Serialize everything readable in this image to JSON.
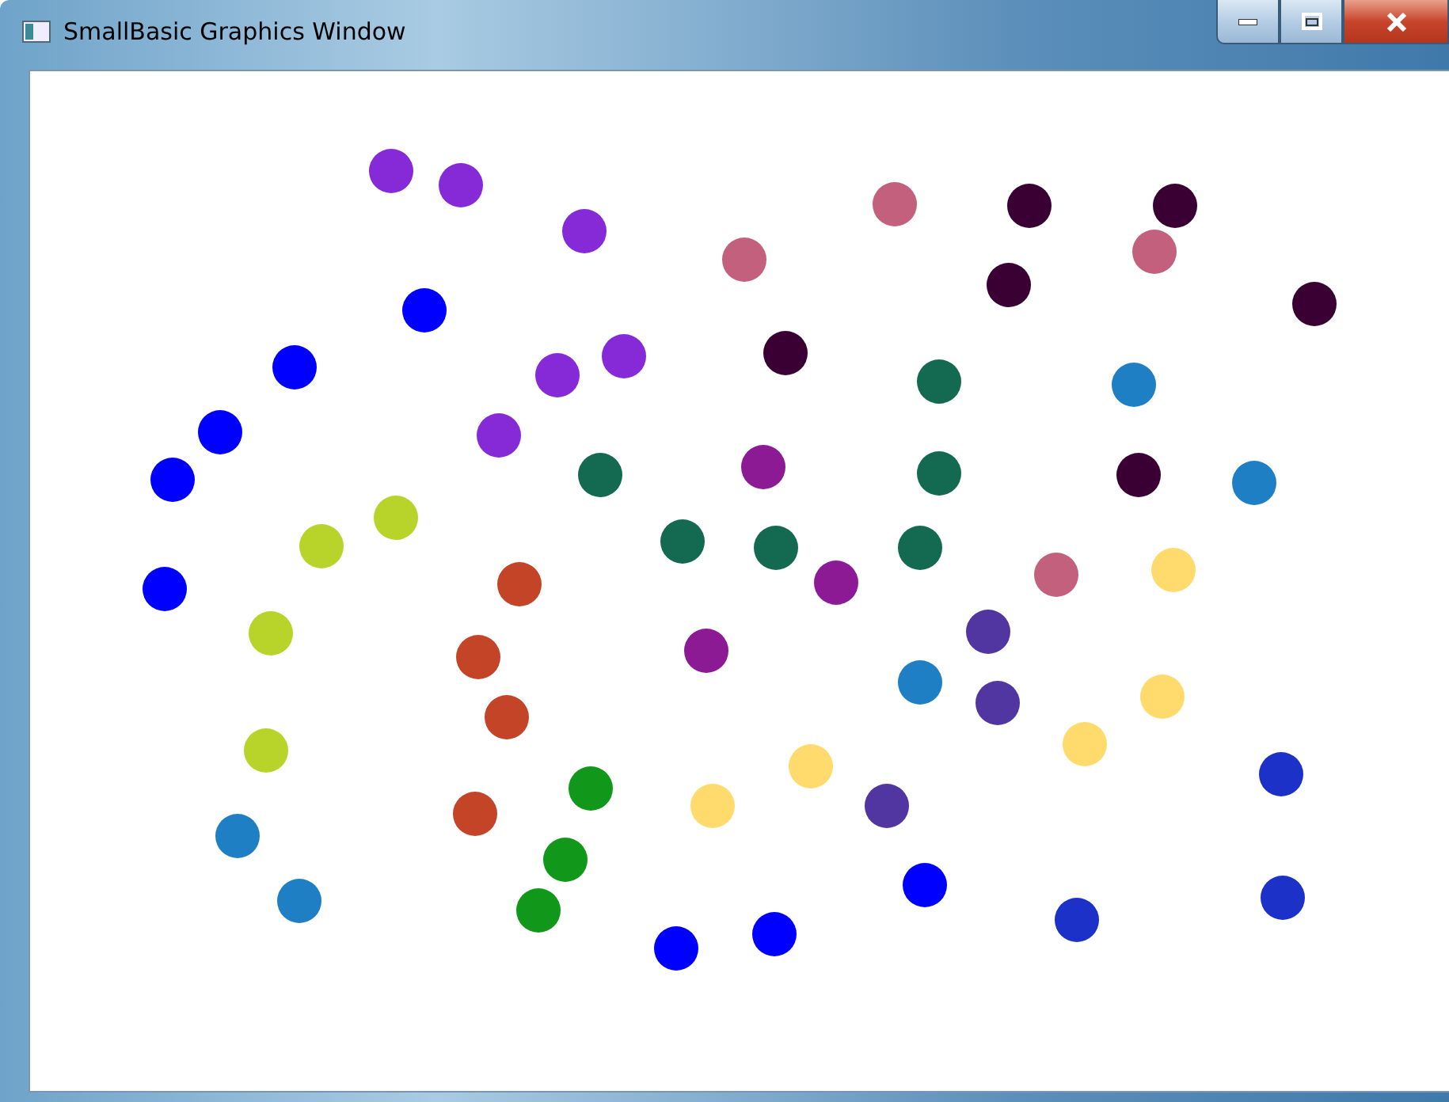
{
  "window": {
    "title": "SmallBasic Graphics Window"
  },
  "dots": [
    {
      "color": "#8629d6"
    },
    {
      "color": "#8629d6"
    },
    {
      "color": "#8629d6"
    },
    {
      "color": "#8629d6"
    },
    {
      "color": "#8629d6"
    },
    {
      "color": "#8629d6"
    },
    {
      "color": "#0000ff"
    },
    {
      "color": "#0000ff"
    },
    {
      "color": "#0000ff"
    },
    {
      "color": "#0000ff"
    },
    {
      "color": "#0000ff"
    },
    {
      "color": "#0000ff"
    },
    {
      "color": "#0000ff"
    },
    {
      "color": "#0000ff"
    },
    {
      "color": "#c2607e"
    },
    {
      "color": "#c2607e"
    },
    {
      "color": "#c2607e"
    },
    {
      "color": "#c2607e"
    },
    {
      "color": "#3a0034"
    },
    {
      "color": "#3a0034"
    },
    {
      "color": "#3a0034"
    },
    {
      "color": "#3a0034"
    },
    {
      "color": "#3a0034"
    },
    {
      "color": "#3a0034"
    },
    {
      "color": "#146a50"
    },
    {
      "color": "#146a50"
    },
    {
      "color": "#146a50"
    },
    {
      "color": "#146a50"
    },
    {
      "color": "#146a50"
    },
    {
      "color": "#146a50"
    },
    {
      "color": "#1e7fc4"
    },
    {
      "color": "#1e7fc4"
    },
    {
      "color": "#1e7fc4"
    },
    {
      "color": "#1e7fc4"
    },
    {
      "color": "#1e7fc4"
    },
    {
      "color": "#8b1a94"
    },
    {
      "color": "#8b1a94"
    },
    {
      "color": "#8b1a94"
    },
    {
      "color": "#b8d42a"
    },
    {
      "color": "#b8d42a"
    },
    {
      "color": "#b8d42a"
    },
    {
      "color": "#b8d42a"
    },
    {
      "color": "#c44428"
    },
    {
      "color": "#c44428"
    },
    {
      "color": "#c44428"
    },
    {
      "color": "#c44428"
    },
    {
      "color": "#ffdb6e"
    },
    {
      "color": "#ffdb6e"
    },
    {
      "color": "#ffdb6e"
    },
    {
      "color": "#ffdb6e"
    },
    {
      "color": "#ffdb6e"
    },
    {
      "color": "#5135a0"
    },
    {
      "color": "#5135a0"
    },
    {
      "color": "#5135a0"
    },
    {
      "color": "#11981a"
    },
    {
      "color": "#11981a"
    },
    {
      "color": "#11981a"
    },
    {
      "color": "#1c31c8"
    },
    {
      "color": "#1c31c8"
    },
    {
      "color": "#1c31c8"
    }
  ]
}
